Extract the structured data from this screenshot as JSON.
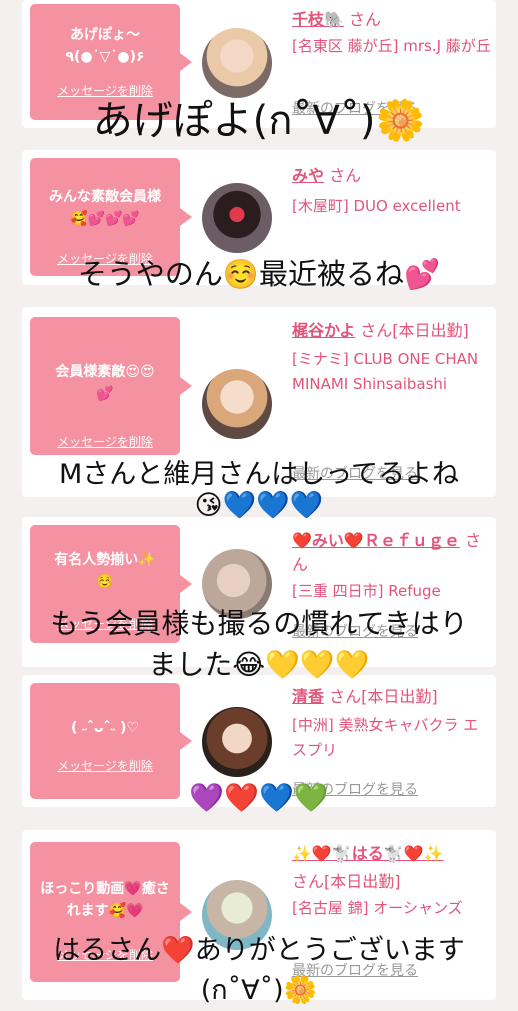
{
  "colors": {
    "bubble": "#f592a2",
    "name": "#e2547a",
    "background": "#f3f0ef"
  },
  "cards": [
    {
      "bubble_text": "あげぽょ〜\n٩(●˙▽˙●)۶",
      "delete": "メッセージを削除",
      "name": "千枝🐘",
      "san": "さん",
      "shop": "[名東区 藤が丘] mrs.J 藤が丘",
      "blog": "最新のブログを見る"
    },
    {
      "bubble_text": "みんな素敵会員様\n🥰💕💕💕",
      "delete": "メッセージを削除",
      "name": "みや",
      "san": "さん",
      "shop": "[木屋町] DUO excellent",
      "blog": "最新のブログを見る"
    },
    {
      "bubble_text": "会員様素敵😍😍\n💕",
      "delete": "メッセージを削除",
      "name": "梶谷かよ",
      "san": "さん[本日出勤]",
      "shop": "[ミナミ] CLUB ONE CHAN MINAMI Shinsaibashi",
      "blog": "最新のブログを見る"
    },
    {
      "bubble_text": "有名人勢揃い✨\n☺️",
      "delete": "メッセージを削除",
      "name": "❤️みい❤️Ｒｅｆｕｇｅ",
      "san": "さん",
      "shop": "[三重 四日市] Refuge",
      "blog": "最新のブログを見る"
    },
    {
      "bubble_text": "( ˶ˆᴗˆ˵ )♡",
      "delete": "メッセージを削除",
      "name": "清香",
      "san": "さん[本日出勤]",
      "shop": "[中洲] 美熟女キャバクラ エスプリ",
      "blog": "最新のブログを見る"
    },
    {
      "bubble_text": "ほっこり動画💗癒されます🥰💗",
      "delete": "メッセージを削除",
      "name": "✨❤️🐩はる🐩❤️✨",
      "san": "さん[本日出勤]",
      "shop": "[名古屋 錦] オーシャンズ",
      "blog": "最新のブログを見る"
    }
  ],
  "overlays": [
    "あげぽよ(ก˚∀˚)🌼",
    "そうやのん☺️最近被るね💕",
    "Mさんと維月さんはしってるよね",
    "😘💙💙💙",
    "もう会員様も撮るの慣れてきはり",
    "ました😂💛💛💛",
    "💜❤️💙💚",
    "はるさん❤️ありがとうございます",
    "(ก˚∀˚)🌼"
  ]
}
